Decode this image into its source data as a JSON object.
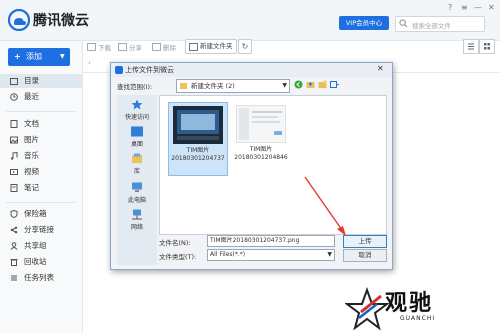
{
  "app": {
    "title": "腾讯微云"
  },
  "header": {
    "vip_label": "VIP会员中心",
    "search_placeholder": "搜索全部文件"
  },
  "sidebar": {
    "add_label": "添加",
    "items": [
      {
        "label": "目录",
        "icon": "folder-icon",
        "active": true
      },
      {
        "label": "最近",
        "icon": "clock-icon"
      },
      {
        "label": "文档",
        "icon": "document-icon"
      },
      {
        "label": "图片",
        "icon": "image-icon"
      },
      {
        "label": "音乐",
        "icon": "music-icon"
      },
      {
        "label": "视频",
        "icon": "video-icon"
      },
      {
        "label": "笔记",
        "icon": "note-icon"
      },
      {
        "label": "保险箱",
        "icon": "safe-icon"
      },
      {
        "label": "分享链接",
        "icon": "share-link-icon"
      },
      {
        "label": "共享组",
        "icon": "group-icon"
      },
      {
        "label": "回收站",
        "icon": "trash-icon"
      },
      {
        "label": "任务列表",
        "icon": "task-list-icon"
      }
    ]
  },
  "toolbar": {
    "download": "下载",
    "share": "分享",
    "delete": "删除",
    "new_folder": "新建文件夹"
  },
  "dialog": {
    "title": "上传文件到微云",
    "lookin_label": "查找范围(I):",
    "lookin_value": "新建文件夹 (2)",
    "places": [
      "快速访问",
      "桌面",
      "库",
      "此电脑",
      "网络"
    ],
    "files": [
      {
        "name": "TIM图片",
        "date": "20180301204737",
        "selected": true
      },
      {
        "name": "TIM图片",
        "date": "20180301204846",
        "selected": false
      }
    ],
    "filename_label": "文件名(N):",
    "filename_value": "TIM图片20180301204737.png",
    "filetype_label": "文件类型(T):",
    "filetype_value": "All Files(*.*)",
    "upload_label": "上传",
    "cancel_label": "取消"
  },
  "watermark": {
    "cn": "观驰",
    "en": "GUANCHI"
  },
  "colors": {
    "accent": "#1e6fe0",
    "arrow": "#e53935"
  }
}
